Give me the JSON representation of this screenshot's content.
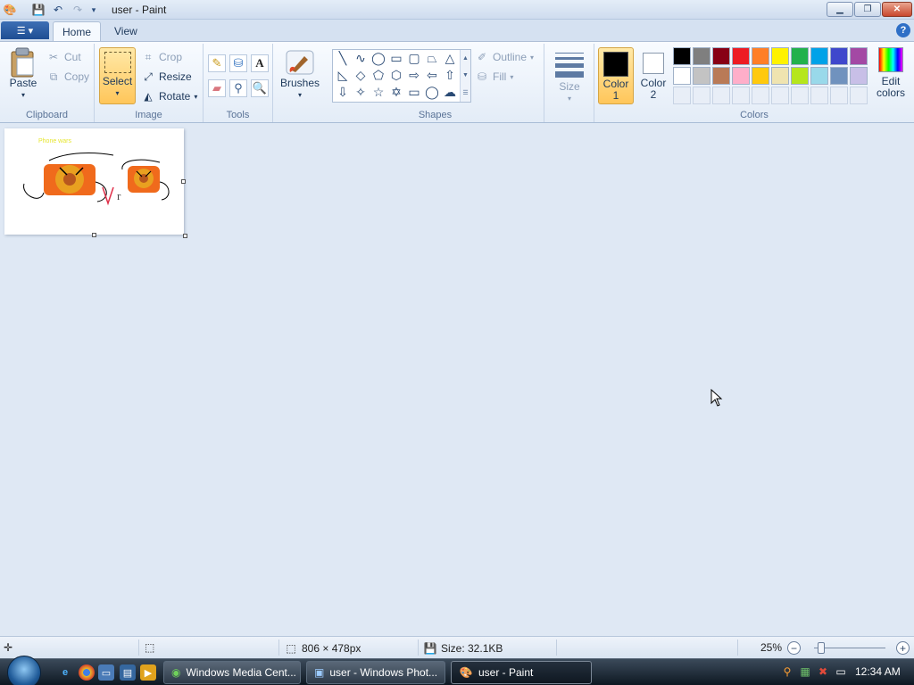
{
  "window": {
    "title": "user - Paint"
  },
  "tabs": {
    "home": "Home",
    "view": "View"
  },
  "clipboard": {
    "paste": "Paste",
    "cut": "Cut",
    "copy": "Copy",
    "group": "Clipboard"
  },
  "image": {
    "select": "Select",
    "crop": "Crop",
    "resize": "Resize",
    "rotate": "Rotate",
    "group": "Image"
  },
  "tools": {
    "group": "Tools"
  },
  "brushes": {
    "label": "Brushes"
  },
  "shapes": {
    "outline": "Outline",
    "fill": "Fill",
    "group": "Shapes"
  },
  "size": {
    "label": "Size"
  },
  "colors": {
    "color1": "Color 1",
    "color1_a": "Color",
    "color1_b": "1",
    "color2": "Color 2",
    "color2_a": "Color",
    "color2_b": "2",
    "color1_value": "#000000",
    "color2_value": "#ffffff",
    "edit_a": "Edit",
    "edit_b": "colors",
    "group": "Colors",
    "palette_row1": [
      "#000000",
      "#7f7f7f",
      "#880015",
      "#ed1c24",
      "#ff7f27",
      "#fff200",
      "#22b14c",
      "#00a2e8",
      "#3f48cc",
      "#a349a4"
    ],
    "palette_row2": [
      "#ffffff",
      "#c3c3c3",
      "#b97a57",
      "#ffaec9",
      "#ffc90e",
      "#efe4b0",
      "#b5e61d",
      "#99d9ea",
      "#7092be",
      "#c8bfe7"
    ]
  },
  "canvas": {
    "drawing_caption": "Phone wars"
  },
  "status": {
    "dimensions": "806 × 478px",
    "size": "Size: 32.1KB",
    "zoom": "25%"
  },
  "zoom_fraction": 0.05,
  "taskbar": {
    "tasks": [
      "Windows Media Cent...",
      "user - Windows Phot...",
      "user - Paint"
    ],
    "clock": "12:34 AM"
  }
}
